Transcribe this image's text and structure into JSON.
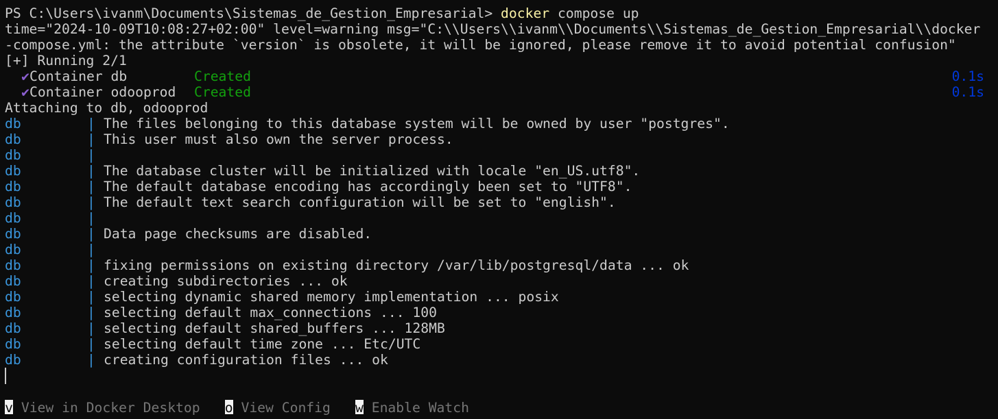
{
  "prompt": {
    "path": "PS C:\\Users\\ivanm\\Documents\\Sistemas_de_Gestion_Empresarial> ",
    "command": "docker",
    "args": " compose up"
  },
  "warning": {
    "line1": "time=\"2024-10-09T10:08:27+02:00\" level=warning msg=\"C:\\\\Users\\\\ivanm\\\\Documents\\\\Sistemas_de_Gestion_Empresarial\\\\docker",
    "line2": "-compose.yml: the attribute `version` is obsolete, it will be ignored, please remove it to avoid potential confusion\""
  },
  "running": "[+] Running 2/1",
  "containers": [
    {
      "check": "✔",
      "name": "Container db",
      "status": "Created",
      "time": "0.1s"
    },
    {
      "check": "✔",
      "name": "Container odooprod",
      "status": "Created",
      "time": "0.1s"
    }
  ],
  "attaching": "Attaching to db, odooprod",
  "log": {
    "pipe": "|",
    "lines": [
      {
        "source": "db",
        "text": "The files belonging to this database system will be owned by user \"postgres\"."
      },
      {
        "source": "db",
        "text": "This user must also own the server process."
      },
      {
        "source": "db",
        "text": ""
      },
      {
        "source": "db",
        "text": "The database cluster will be initialized with locale \"en_US.utf8\"."
      },
      {
        "source": "db",
        "text": "The default database encoding has accordingly been set to \"UTF8\"."
      },
      {
        "source": "db",
        "text": "The default text search configuration will be set to \"english\"."
      },
      {
        "source": "db",
        "text": ""
      },
      {
        "source": "db",
        "text": "Data page checksums are disabled."
      },
      {
        "source": "db",
        "text": ""
      },
      {
        "source": "db",
        "text": "fixing permissions on existing directory /var/lib/postgresql/data ... ok"
      },
      {
        "source": "db",
        "text": "creating subdirectories ... ok"
      },
      {
        "source": "db",
        "text": "selecting dynamic shared memory implementation ... posix"
      },
      {
        "source": "db",
        "text": "selecting default max_connections ... 100"
      },
      {
        "source": "db",
        "text": "selecting default shared_buffers ... 128MB"
      },
      {
        "source": "db",
        "text": "selecting default time zone ... Etc/UTC"
      },
      {
        "source": "db",
        "text": "creating configuration files ... ok"
      }
    ]
  },
  "footer": [
    {
      "key": "v",
      "label": " View in Docker Desktop"
    },
    {
      "key": "o",
      "label": " View Config"
    },
    {
      "key": "w",
      "label": " Enable Watch"
    }
  ],
  "colors": {
    "background": "#0c0c0c",
    "foreground": "#cccccc",
    "command": "#f9f1a5",
    "status_created": "#13a10e",
    "timing": "#0037da",
    "log_prefix": "#3a96dd",
    "checkmark": "#8b5fd0",
    "footer_label": "#767676"
  }
}
